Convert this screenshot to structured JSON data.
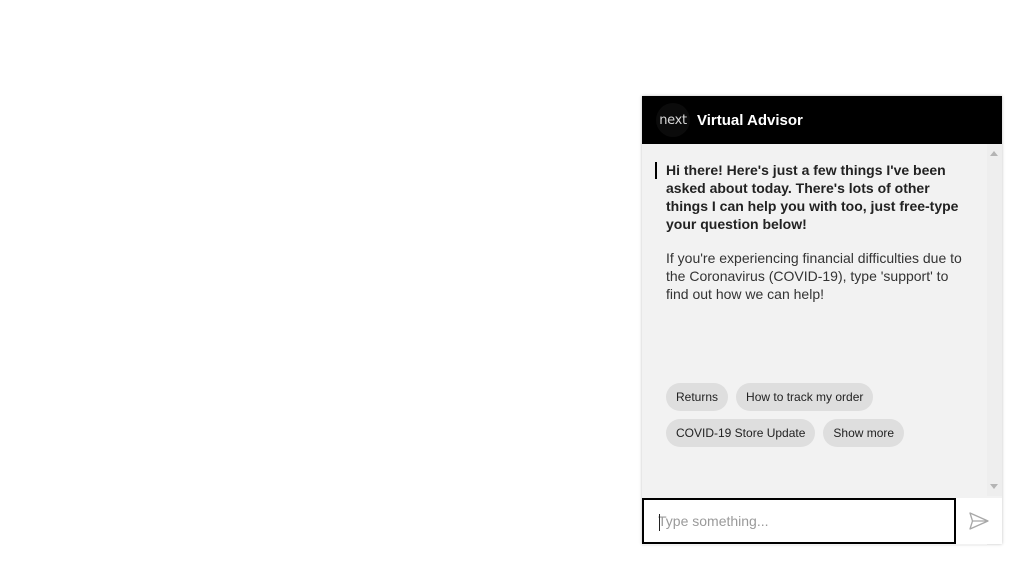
{
  "header": {
    "logo_text": "next",
    "title": "Virtual Advisor"
  },
  "messages": {
    "greeting": "Hi there! Here's just a few things I've been asked about today. There's lots of other things I can help you with too, just free-type your question below!",
    "covid_note": "If you're experiencing financial difficulties due to the Coronavirus (COVID-19), type 'support' to find out how we can help!"
  },
  "quick_replies": [
    {
      "label": "Returns"
    },
    {
      "label": "How to track my order"
    },
    {
      "label": "COVID-19 Store Update"
    },
    {
      "label": "Show more"
    }
  ],
  "input": {
    "placeholder": "Type something...",
    "value": ""
  },
  "icons": {
    "send": "send-icon",
    "scroll_up": "scroll-up-arrow-icon",
    "scroll_down": "scroll-down-arrow-icon"
  },
  "colors": {
    "header_bg": "#000000",
    "panel_bg": "#f2f2f2",
    "chip_bg": "#dedede",
    "input_border": "#000000"
  }
}
